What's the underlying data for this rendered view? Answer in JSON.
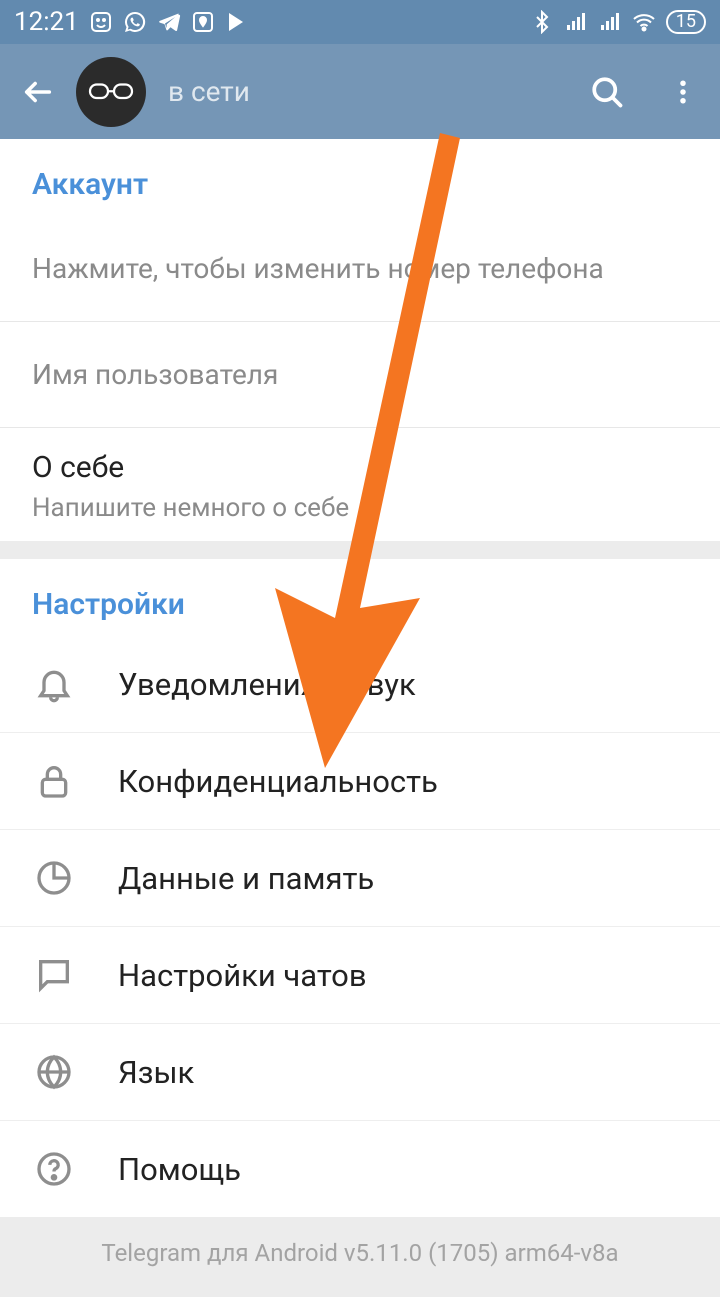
{
  "status": {
    "time": "12:21",
    "battery": "15"
  },
  "appbar": {
    "online_status": "в сети"
  },
  "account": {
    "section_title": "Аккаунт",
    "phone_hint": "Нажмите, чтобы изменить номер телефона",
    "username_hint": "Имя пользователя",
    "about_title": "О себе",
    "about_hint": "Напишите немного о себе"
  },
  "settings": {
    "section_title": "Настройки",
    "items": [
      {
        "label": "Уведомления и звук"
      },
      {
        "label": "Конфиденциальность"
      },
      {
        "label": "Данные и память"
      },
      {
        "label": "Настройки чатов"
      },
      {
        "label": "Язык"
      },
      {
        "label": "Помощь"
      }
    ]
  },
  "footer": {
    "version": "Telegram для Android v5.11.0 (1705) arm64-v8a"
  }
}
